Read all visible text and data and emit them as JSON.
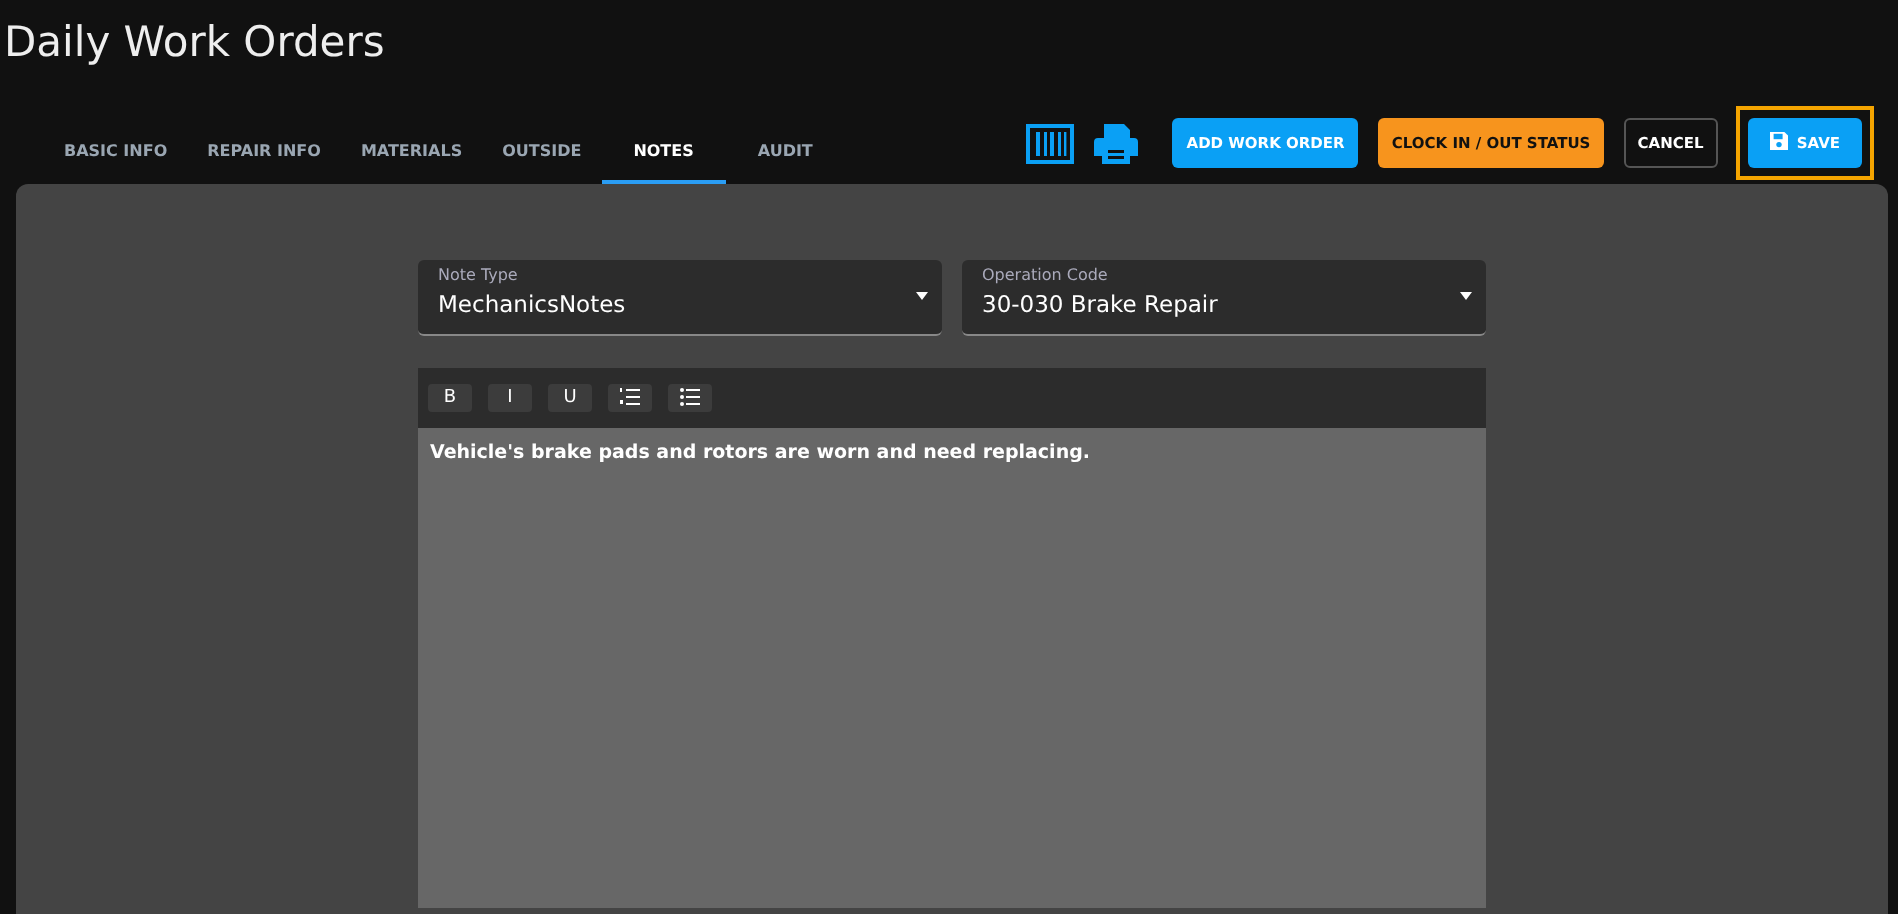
{
  "title": "Daily Work Orders",
  "tabs": [
    {
      "label": "BASIC INFO",
      "selected": false
    },
    {
      "label": "REPAIR INFO",
      "selected": false
    },
    {
      "label": "MATERIALS",
      "selected": false
    },
    {
      "label": "OUTSIDE",
      "selected": false
    },
    {
      "label": "NOTES",
      "selected": true
    },
    {
      "label": "AUDIT",
      "selected": false
    }
  ],
  "actions": [
    {
      "kind": "primary",
      "label": "ADD WORK ORDER",
      "highlighted": false
    },
    {
      "kind": "warning",
      "label": "CLOCK IN / OUT STATUS",
      "highlighted": false
    },
    {
      "kind": "outline",
      "label": "CANCEL",
      "highlighted": false
    },
    {
      "kind": "save",
      "label": "SAVE",
      "highlighted": true
    }
  ],
  "fields": [
    {
      "label": "Note Type",
      "value": "MechanicsNotes"
    },
    {
      "label": "Operation Code",
      "value": "30-030 Brake Repair"
    }
  ],
  "editor": {
    "toolbar": [
      {
        "kind": "text",
        "label": "B"
      },
      {
        "kind": "text",
        "label": "I"
      },
      {
        "kind": "text",
        "label": "U"
      },
      {
        "kind": "ordered-list"
      },
      {
        "kind": "bullet-list"
      }
    ],
    "text": "Vehicle's brake pads and rotors are worn and need replacing."
  }
}
